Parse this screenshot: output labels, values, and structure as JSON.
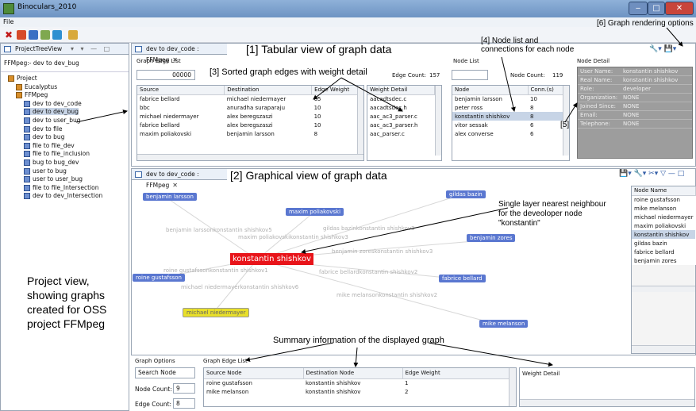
{
  "window": {
    "title": "Binoculars_2010"
  },
  "menu": {
    "file": "File"
  },
  "annotations": {
    "render_opts": "[6] Graph rendering options",
    "tabular": "[1] Tabular view of graph data",
    "node_list1": "[4] Node list and",
    "node_list2": "connections for each node",
    "sorted": "[3] Sorted graph edges with weight detail",
    "five": "[5]",
    "graphical": "[2] Graphical view of graph data",
    "single1": "Single layer nearest neighbour",
    "single2": "for the deveoloper node",
    "single3": "\"konstantin\"",
    "project1": "Project view,",
    "project2": "showing graphs",
    "project3": "created for OSS",
    "project4": "project FFMpeg",
    "summary": "Summary information of the displayed graph"
  },
  "tree": {
    "tab": "ProjectTreeView",
    "root_label": "FFMpeg:- dev to dev_bug",
    "items": [
      "Project",
      "Eucalyptus",
      "FFMpeg",
      "dev to dev_code",
      "dev to dev_bug",
      "dev to user_bug",
      "dev to file",
      "dev to bug",
      "file to file_dev",
      "file to file_inclusion",
      "bug to bug_dev",
      "user to bug",
      "user to user_bug",
      "file to file_Intersection",
      "dev to dev_Intersection"
    ]
  },
  "tabular": {
    "tab": "dev to dev_code : FFMpeg",
    "edge_list_title": "Graph Edge List",
    "search_value": "00000",
    "edge_count_label": "Edge Count:",
    "edge_count": "157",
    "headers": [
      "Source",
      "Destination",
      "Edge Weight",
      "Weight Detail"
    ],
    "rows": [
      [
        "fabrice bellard",
        "michael niedermayer",
        "65",
        "aacadtsdec.c"
      ],
      [
        "bbc",
        "anuradha suraparaju",
        "10",
        "aacadtsdec.h"
      ],
      [
        "michael niedermayer",
        "alex beregszaszi",
        "10",
        "aac_ac3_parser.c"
      ],
      [
        "fabrice bellard",
        "alex beregszaszi",
        "10",
        "aac_ac3_parser.h"
      ],
      [
        "maxim poliakovski",
        "benjamin larsson",
        "8",
        "aac_parser.c"
      ]
    ],
    "node_list_title": "Node List",
    "node_count_label": "Node Count:",
    "node_count": "119",
    "node_headers": [
      "Node",
      "Conn.(s)"
    ],
    "node_rows": [
      [
        "benjamin larsson",
        "10"
      ],
      [
        "peter ross",
        "8"
      ],
      [
        "konstantin shishkov",
        "8"
      ],
      [
        "vitor sessak",
        "6"
      ],
      [
        "alex converse",
        "6"
      ]
    ],
    "detail_title": "Node Detail",
    "detail_rows": [
      [
        "User Name:",
        "konstantin shishkov"
      ],
      [
        "Real Name:",
        "konstantin shishkov"
      ],
      [
        "Role:",
        "developer"
      ],
      [
        "Organization:",
        "NONE"
      ],
      [
        "Joined Since:",
        "NONE"
      ],
      [
        "Email:",
        "NONE"
      ],
      [
        "Telephone:",
        "NONE"
      ]
    ]
  },
  "graph": {
    "tab": "dev to dev_code : FFMpeg",
    "nodes": {
      "center": "konstantin shishkov",
      "n1": "benjamin larsson",
      "n2": "maxim poliakovski",
      "n3": "gildas bazin",
      "n4": "benjamin zores",
      "n5": "roine gustafsson",
      "n6": "fabrice bellard",
      "n7": "michael niedermayer",
      "n8": "mike melanson"
    },
    "edge_labels": [
      "benjamin larssonkonstantin shishkov5",
      "maxim poliakovskikonstantin shishkov3",
      "gildas bazinkonstantin shishkov3",
      "benjamin zoreskonstantin shishkov3",
      "roine gustafssonkonstantin shishkov1",
      "fabrice bellardkonstantin shishkov2",
      "michael niedermayerkonstantin shishkov6",
      "mike melansonkonstantin shishkov2"
    ],
    "node_name_header": "Node Name",
    "node_names": [
      "roine gustafsson",
      "mike melanson",
      "michael niedermayer",
      "maxim poliakovski",
      "konstantin shishkov",
      "gildas bazin",
      "fabrice bellard",
      "benjamin zores"
    ]
  },
  "summary": {
    "options_title": "Graph Options",
    "search_node": "Search Node",
    "node_count_label": "Node Count:",
    "node_count": "9",
    "edge_count_label": "Edge Count:",
    "edge_count": "8",
    "edge_list_title": "Graph Edge List",
    "headers": [
      "Source Node",
      "Destination Node",
      "Edge Weight"
    ],
    "rows": [
      [
        "roine gustafsson",
        "konstantin shishkov",
        "1"
      ],
      [
        "mike melanson",
        "konstantin shishkov",
        "2"
      ]
    ],
    "weight_detail": "Weight Detail"
  }
}
